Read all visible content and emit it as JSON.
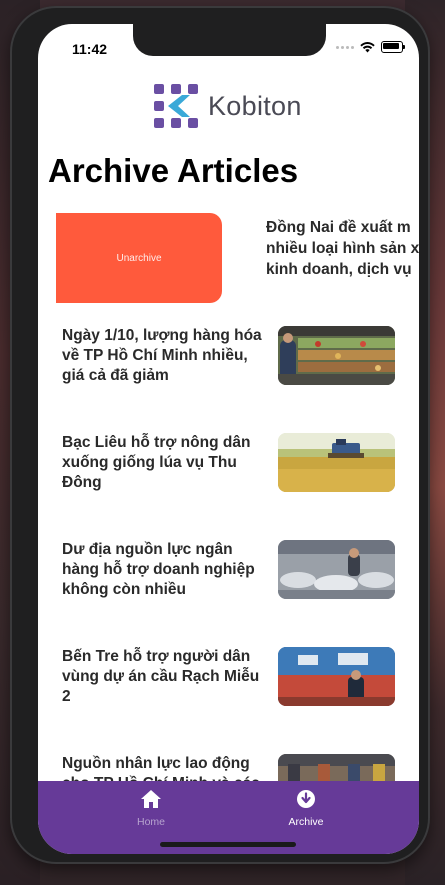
{
  "status_bar": {
    "time": "11:42"
  },
  "logo": {
    "text": "Kobiton"
  },
  "page": {
    "title": "Archive Articles"
  },
  "swipe_row": {
    "action_label": "Unarchive",
    "article_lines": [
      "Đồng Nai đề xuất m",
      "nhiều loại hình sản x",
      "kinh doanh, dịch vụ"
    ]
  },
  "articles": [
    {
      "title": "Ngày 1/10, lượng hàng hóa về TP Hồ Chí Minh nhiều, giá cả đã giảm",
      "thumb_icon": "market-photo"
    },
    {
      "title": "Bạc Liêu hỗ trợ nông dân xuống giống lúa vụ Thu Đông",
      "thumb_icon": "rice-field-photo"
    },
    {
      "title": "Dư địa nguồn lực ngân hàng hỗ trợ doanh nghiệp không còn nhiều",
      "thumb_icon": "factory-photo"
    },
    {
      "title": "Bến Tre hỗ trợ người dân vùng dự án cầu Rạch Miễu 2",
      "thumb_icon": "meeting-photo"
    },
    {
      "title": "Nguồn nhân lực lao động cho TP Hồ Chí Minh và các",
      "thumb_icon": "workers-photo"
    }
  ],
  "tabbar": {
    "home_label": "Home",
    "archive_label": "Archive",
    "color": "#663a98",
    "active_color": "#ffffff",
    "inactive_color": "#b7a4cf"
  },
  "colors": {
    "unarchive": "#ff5a3c"
  }
}
